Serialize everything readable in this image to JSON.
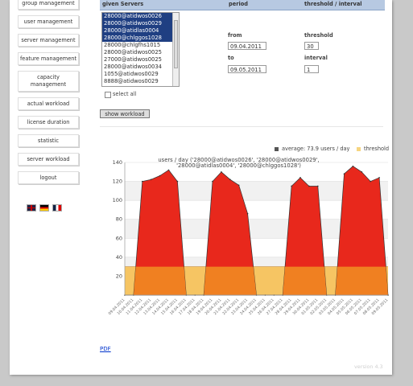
{
  "sidebar": {
    "items": [
      {
        "label": "group management"
      },
      {
        "label": "user management"
      },
      {
        "label": "server management"
      },
      {
        "label": "feature management"
      },
      {
        "label": "capacity management"
      },
      {
        "label": "actual workload"
      },
      {
        "label": "license duration"
      },
      {
        "label": "statistic"
      },
      {
        "label": "server workload"
      },
      {
        "label": "logout"
      }
    ]
  },
  "form": {
    "headers": {
      "servers": "given Servers",
      "period": "period",
      "threshold": "threshold / interval"
    },
    "servers": [
      {
        "name": "28000@atidwos0026",
        "selected": true
      },
      {
        "name": "28000@atidwos0029",
        "selected": true
      },
      {
        "name": "28000@atidlas0004",
        "selected": true
      },
      {
        "name": "28000@chlggos1028",
        "selected": true
      },
      {
        "name": "28000@chlgfhs1015",
        "selected": false
      },
      {
        "name": "28000@atidwos0025",
        "selected": false
      },
      {
        "name": "27000@atidwos0025",
        "selected": false
      },
      {
        "name": "28000@atidwos0034",
        "selected": false
      },
      {
        "name": "1055@atidwos0029",
        "selected": false
      },
      {
        "name": "8888@atidwos0029",
        "selected": false
      }
    ],
    "from_label": "from",
    "from_value": "09.04.2011",
    "to_label": "to",
    "to_value": "09.05.2011",
    "threshold_label": "threshold",
    "threshold_value": "30",
    "interval_label": "interval",
    "interval_value": "1",
    "select_all_label": "select all",
    "show_button": "show workload"
  },
  "legend": {
    "average_label": "average: 73.9 users / day",
    "threshold_label": "threshold",
    "average_color": "#555555",
    "threshold_color": "#f6d580"
  },
  "chart_data": {
    "type": "area",
    "title": "users / day ('28000@atidwos0026', '28000@atidwos0029', '28000@atidlas0004', '28000@chlggos1028')",
    "title_lines": [
      "users / day ('28000@atidwos0026', '28000@atidwos0029',",
      "'28000@atidlas0004', '28000@chlggos1028')"
    ],
    "ylim": [
      0,
      140
    ],
    "yticks": [
      20,
      40,
      60,
      80,
      100,
      120,
      140
    ],
    "threshold": 30,
    "x": [
      "09.04.2011",
      "10.04.2011",
      "11.04.2011",
      "12.04.2011",
      "13.04.2011",
      "14.04.2011",
      "15.04.2011",
      "16.04.2011",
      "17.04.2011",
      "18.04.2011",
      "19.04.2011",
      "20.04.2011",
      "21.04.2011",
      "22.04.2011",
      "23.04.2011",
      "24.04.2011",
      "25.04.2011",
      "26.04.2011",
      "27.04.2011",
      "28.04.2011",
      "29.04.2011",
      "30.04.2011",
      "01.05.2011",
      "02.05.2011",
      "03.05.2011",
      "04.05.2011",
      "05.05.2011",
      "06.05.2011",
      "07.05.2011",
      "08.05.2011",
      "09.05.2011"
    ],
    "series": [
      {
        "values": [
          0,
          0,
          120,
          122,
          126,
          132,
          120,
          0,
          0,
          0,
          120,
          130,
          122,
          116,
          86,
          0,
          0,
          0,
          0,
          115,
          124,
          115,
          115,
          0,
          0,
          128,
          136,
          130,
          120,
          124,
          0
        ],
        "color": "#e8281c"
      }
    ],
    "threshold_color": "#f6c563",
    "overlap_color": "#f08021",
    "grid": true
  },
  "footer": {
    "pdf_label": "PDF",
    "version": "version 4.3"
  }
}
